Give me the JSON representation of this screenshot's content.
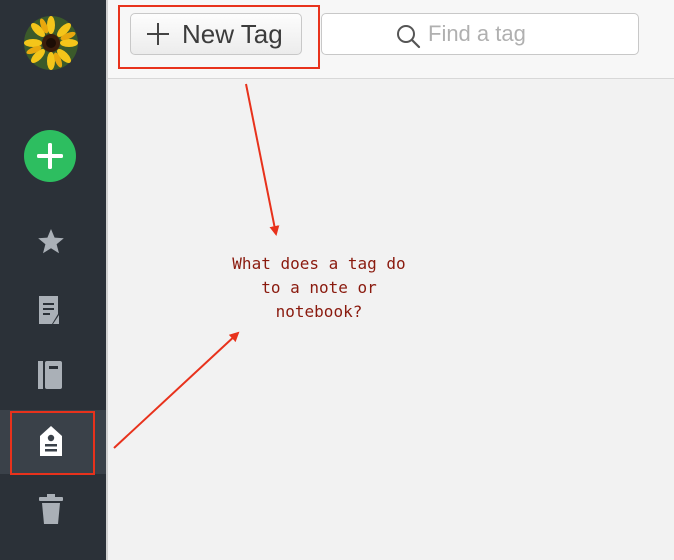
{
  "sidebar": {
    "items": [
      {
        "name": "shortcuts",
        "icon": "star-icon"
      },
      {
        "name": "notes",
        "icon": "note-icon"
      },
      {
        "name": "notebooks",
        "icon": "notebook-icon"
      },
      {
        "name": "tags",
        "icon": "tag-icon",
        "active": true
      },
      {
        "name": "trash",
        "icon": "trash-icon"
      }
    ],
    "new_note_icon": "plus-icon",
    "avatar_icon": "sunflower-avatar"
  },
  "toolbar": {
    "new_tag_label": "New Tag",
    "search_placeholder": "Find a tag",
    "search_value": ""
  },
  "annotation": {
    "question": "What does a tag do\nto a note or\nnotebook?"
  },
  "colors": {
    "sidebar_bg": "#2b3138",
    "accent_green": "#2dbe60",
    "annotation_red": "#e8321c",
    "annotation_text": "#8a1a0e"
  }
}
